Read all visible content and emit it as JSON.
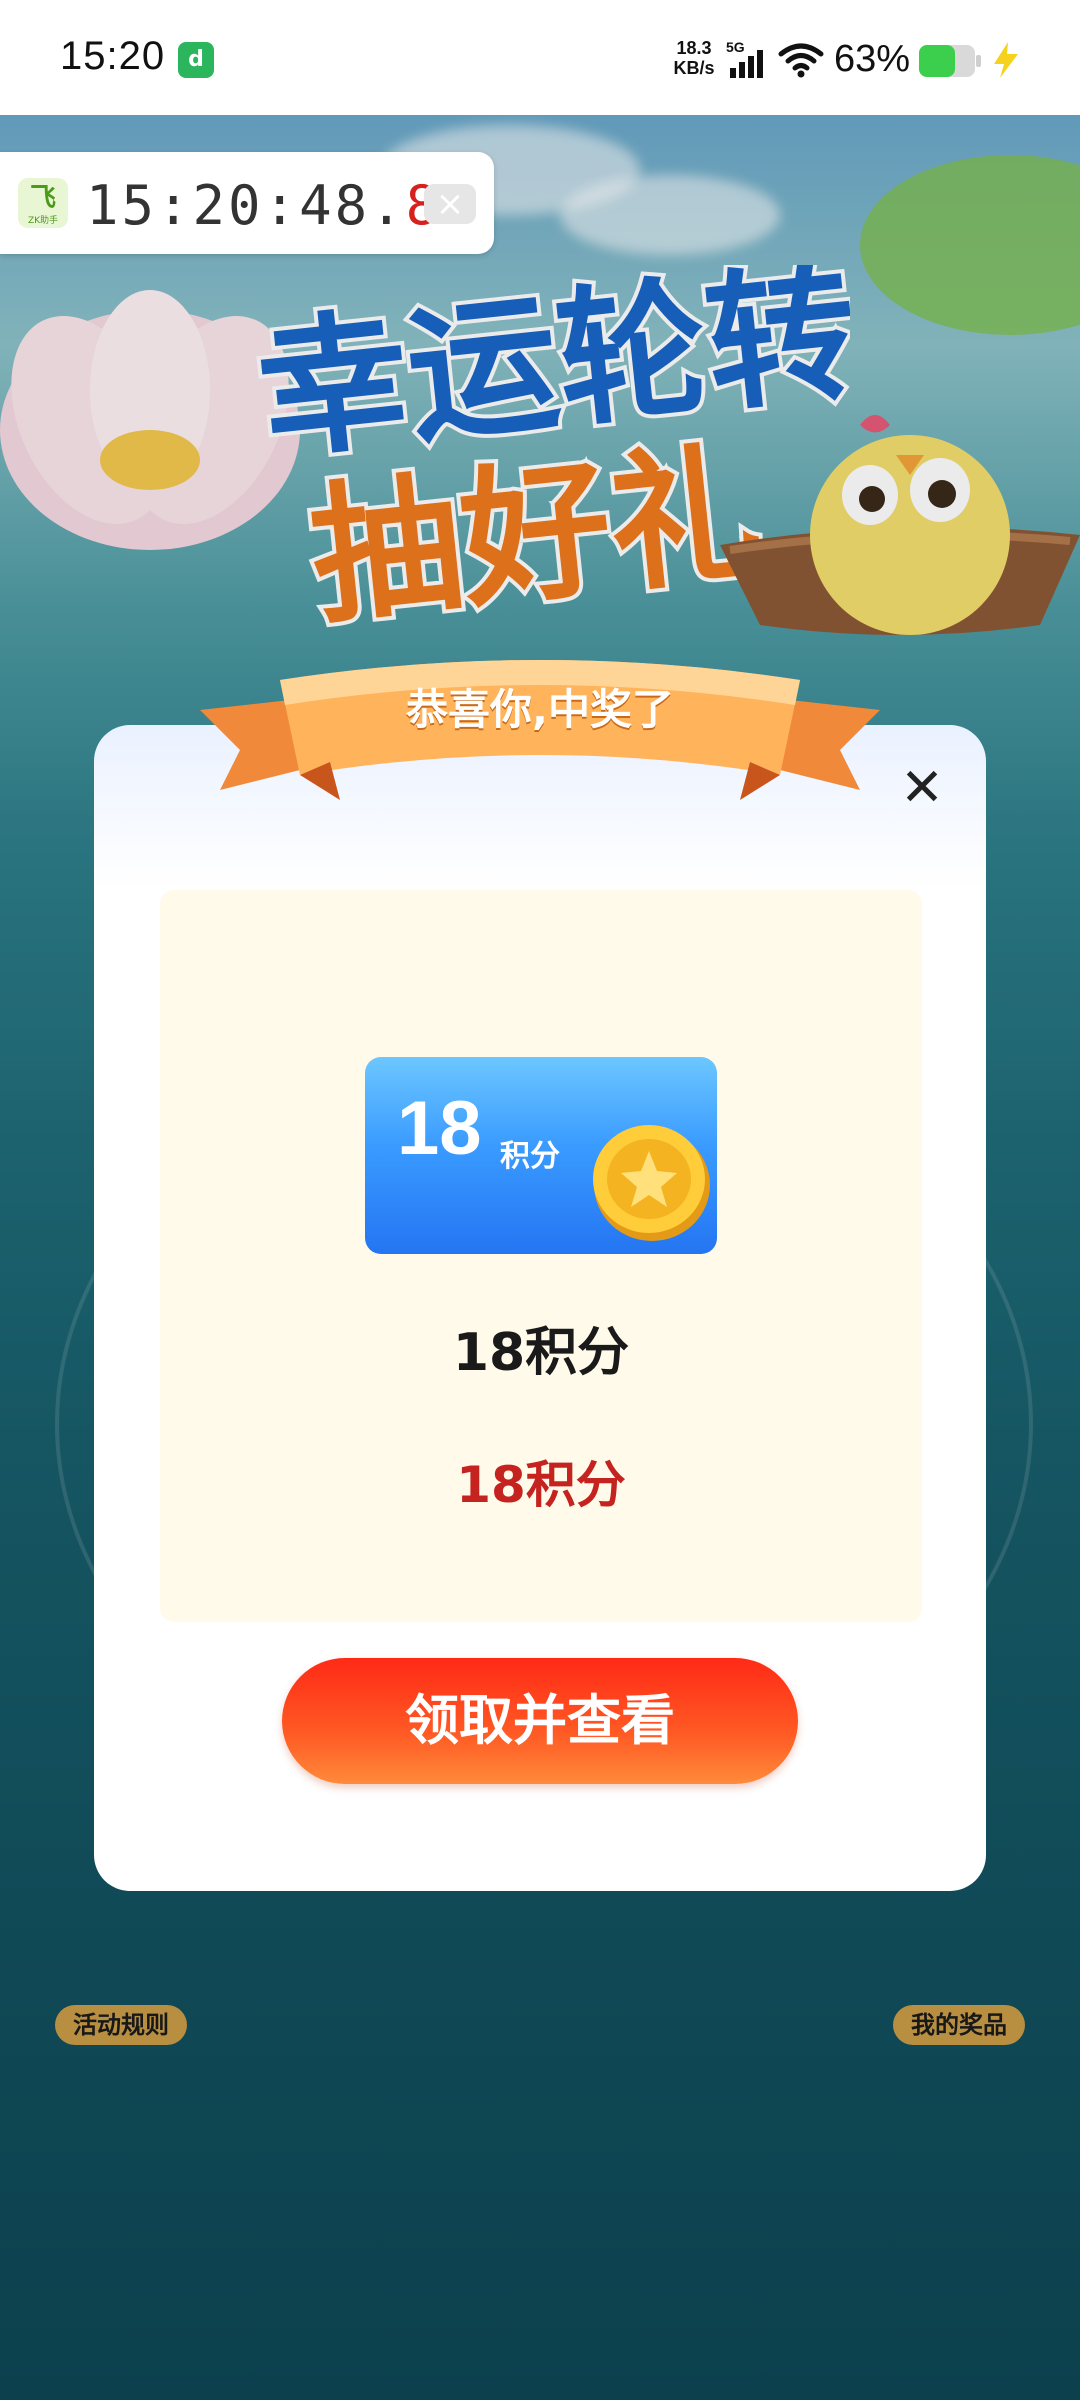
{
  "status_bar": {
    "time": "15:20",
    "net_speed_value": "18.3",
    "net_speed_unit": "KB/s",
    "network_type": "5G",
    "battery": "63%"
  },
  "timer_widget": {
    "time_main": "15:20:48.",
    "time_ms": "8",
    "close_glyph": "×",
    "logo_text": "ZK助手"
  },
  "background": {
    "title_line1": "幸运轮转",
    "title_line2": "抽好礼",
    "rules_label": "活动规则",
    "prizes_label": "我的奖品"
  },
  "dialog": {
    "ribbon_title": "恭喜你,中奖了",
    "close_glyph": "✕",
    "prize_card_value": "18",
    "prize_card_unit": "积分",
    "prize_name": "18积分",
    "prize_desc": "18积分",
    "claim_button_label": "领取并查看"
  },
  "colors": {
    "accent_red": "#c52320",
    "button_red": "#ff2a16",
    "card_blue": "#2475f2",
    "panel_cream": "#fffaea"
  }
}
